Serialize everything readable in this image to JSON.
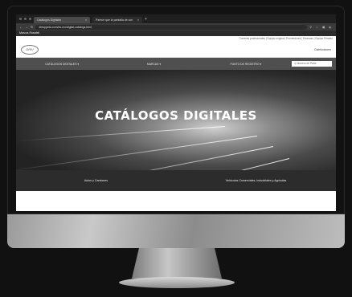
{
  "browser": {
    "tabs": [
      {
        "label": "Catálogos Digitales",
        "active": true
      },
      {
        "label": "Parece que la pantalla de con",
        "active": false
      }
    ],
    "url": "dirtuppeta.com/es-mx/digital-catalogs.html",
    "bookmark": "Marcos Rosafell"
  },
  "site": {
    "top_links": "Carreras profesionales | Equipo original | Proveedores | Finanzas | Equipo Pesado",
    "logo": "DRiV",
    "distributor": "Distribuidores",
    "nav": [
      "CATÁLOGOS DIGITALES ▾",
      "MARCAS ▾",
      "PUNTO DE REGISTRO ▾"
    ],
    "search_placeholder": "Número de Parte",
    "hero_title": "CATÁLOGOS DIGITALES",
    "bottom_items": [
      "Autos y Camiones",
      "Vehículos Comerciales, Industriales y Agrícolas"
    ]
  }
}
